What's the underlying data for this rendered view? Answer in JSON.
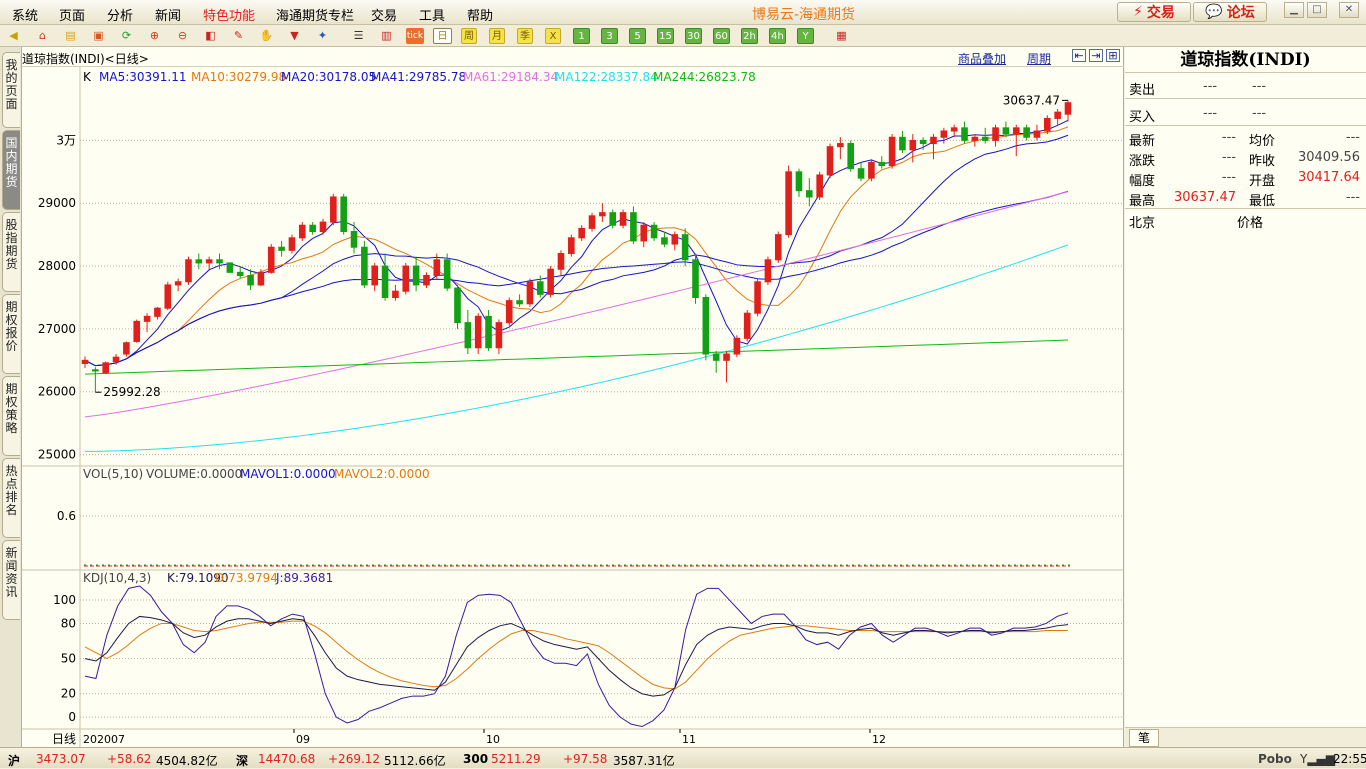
{
  "app_title": "博易云-海通期货",
  "menu": [
    "系统",
    "页面",
    "分析",
    "新闻",
    "特色功能",
    "海通期货专栏",
    "交易",
    "工具",
    "帮助"
  ],
  "top_buttons": {
    "trade": "交易",
    "forum": "论坛"
  },
  "toolbar": {
    "periods": [
      "日",
      "周",
      "月",
      "季",
      "X",
      "1",
      "3",
      "5",
      "15",
      "30",
      "60",
      "2h",
      "4h",
      "Y"
    ],
    "tick": "tick"
  },
  "sidebar": [
    "我的页面",
    "国内期货",
    "股指期货",
    "期权报价",
    "期权策略",
    "热点排名",
    "新闻资讯"
  ],
  "chart": {
    "symbol_title": "道琼指数(INDI)<日线>",
    "overlay_link": "商品叠加",
    "period_link": "周期",
    "ma_prefix": "K",
    "ma_labels": [
      {
        "text": "MA5:30391.11",
        "color": "#1414c8"
      },
      {
        "text": "MA10:30279.98",
        "color": "#e07a12"
      },
      {
        "text": "MA20:30178.05",
        "color": "#1414c8"
      },
      {
        "text": "MA41:29785.78",
        "color": "#1414c8"
      },
      {
        "text": "MA61:29184.34",
        "color": "#e070e0"
      },
      {
        "text": "MA122:28337.84",
        "color": "#1ee0ee"
      },
      {
        "text": "MA244:26823.78",
        "color": "#12b812"
      }
    ],
    "price_ticks": [
      "3万",
      "29000",
      "28000",
      "27000",
      "26000",
      "25000"
    ],
    "high_label": "30637.47",
    "low_label": "25992.28",
    "vol_header": {
      "name": "VOL(5,10)",
      "volume": "VOLUME:0.0000",
      "mavol1": "MAVOL1:0.0000",
      "mavol2": "MAVOL2:0.0000"
    },
    "vol_tick": "0.6",
    "kdj_header": {
      "name": "KDJ(10,4,3)",
      "k": "K:79.1090",
      "d": "D:73.9794",
      "j": "J:89.3681"
    },
    "kdj_ticks": [
      "100",
      "80",
      "50",
      "20",
      "0"
    ],
    "x_axis_name": "日线",
    "x_labels": [
      "202007",
      "09",
      "10",
      "11",
      "12"
    ]
  },
  "chart_data": {
    "type": "candlestick",
    "title": "道琼指数(INDI)<日线>",
    "x_months": [
      "202007",
      "09",
      "10",
      "11",
      "12"
    ],
    "ohlc_approx": [
      [
        26450,
        26560,
        26380,
        26500
      ],
      [
        26350,
        26390,
        25992,
        26330
      ],
      [
        26300,
        26480,
        26280,
        26460
      ],
      [
        26480,
        26600,
        26430,
        26550
      ],
      [
        26600,
        26800,
        26560,
        26780
      ],
      [
        26800,
        27150,
        26780,
        27120
      ],
      [
        27120,
        27250,
        26950,
        27200
      ],
      [
        27200,
        27350,
        27150,
        27330
      ],
      [
        27330,
        27750,
        27300,
        27700
      ],
      [
        27700,
        27800,
        27600,
        27750
      ],
      [
        27750,
        28150,
        27700,
        28100
      ],
      [
        28100,
        28200,
        27950,
        28050
      ],
      [
        28050,
        28150,
        27950,
        28100
      ],
      [
        28100,
        28200,
        27950,
        28050
      ],
      [
        28050,
        28050,
        27900,
        27900
      ],
      [
        27900,
        28000,
        27800,
        27850
      ],
      [
        27850,
        27950,
        27620,
        27700
      ],
      [
        27700,
        27950,
        27680,
        27900
      ],
      [
        27900,
        28350,
        27880,
        28300
      ],
      [
        28300,
        28400,
        28150,
        28250
      ],
      [
        28250,
        28500,
        28200,
        28450
      ],
      [
        28450,
        28700,
        28400,
        28650
      ],
      [
        28650,
        28700,
        28500,
        28550
      ],
      [
        28550,
        28750,
        28500,
        28700
      ],
      [
        28700,
        29150,
        28650,
        29100
      ],
      [
        29100,
        29150,
        28500,
        28550
      ],
      [
        28550,
        28700,
        28200,
        28300
      ],
      [
        28300,
        28400,
        27650,
        27700
      ],
      [
        27700,
        28050,
        27600,
        28000
      ],
      [
        28000,
        28200,
        27450,
        27500
      ],
      [
        27500,
        27700,
        27450,
        27600
      ],
      [
        27600,
        28050,
        27550,
        28000
      ],
      [
        28000,
        28150,
        27600,
        27700
      ],
      [
        27700,
        27900,
        27650,
        27850
      ],
      [
        27850,
        28200,
        27800,
        28100
      ],
      [
        28100,
        28200,
        27600,
        27650
      ],
      [
        27650,
        27700,
        27000,
        27100
      ],
      [
        27100,
        27300,
        26600,
        26700
      ],
      [
        26700,
        27250,
        26600,
        27200
      ],
      [
        27200,
        27300,
        26650,
        26700
      ],
      [
        26700,
        27150,
        26600,
        27100
      ],
      [
        27100,
        27500,
        27050,
        27450
      ],
      [
        27450,
        27550,
        27350,
        27400
      ],
      [
        27400,
        27800,
        27350,
        27750
      ],
      [
        27750,
        27850,
        27500,
        27550
      ],
      [
        27550,
        28000,
        27500,
        27950
      ],
      [
        27950,
        28250,
        27850,
        28200
      ],
      [
        28200,
        28500,
        28150,
        28450
      ],
      [
        28450,
        28650,
        28400,
        28600
      ],
      [
        28600,
        28850,
        28550,
        28800
      ],
      [
        28800,
        29000,
        28700,
        28850
      ],
      [
        28850,
        28900,
        28600,
        28650
      ],
      [
        28650,
        28900,
        28600,
        28850
      ],
      [
        28850,
        28950,
        28350,
        28400
      ],
      [
        28400,
        28700,
        28300,
        28650
      ],
      [
        28650,
        28700,
        28400,
        28450
      ],
      [
        28450,
        28550,
        28300,
        28350
      ],
      [
        28350,
        28550,
        28250,
        28500
      ],
      [
        28500,
        28600,
        28000,
        28100
      ],
      [
        28100,
        28200,
        27400,
        27500
      ],
      [
        27500,
        27550,
        26500,
        26600
      ],
      [
        26600,
        26650,
        26300,
        26500
      ],
      [
        26500,
        26650,
        26150,
        26600
      ],
      [
        26600,
        26900,
        26550,
        26850
      ],
      [
        26850,
        27300,
        26800,
        27250
      ],
      [
        27250,
        27800,
        27200,
        27750
      ],
      [
        27750,
        28150,
        27700,
        28100
      ],
      [
        28100,
        28550,
        28050,
        28500
      ],
      [
        28500,
        29600,
        28450,
        29500
      ],
      [
        29500,
        29550,
        29100,
        29200
      ],
      [
        29200,
        29400,
        28950,
        29100
      ],
      [
        29100,
        29500,
        29050,
        29450
      ],
      [
        29450,
        29950,
        29400,
        29900
      ],
      [
        29900,
        30050,
        29700,
        29950
      ],
      [
        29950,
        30000,
        29500,
        29550
      ],
      [
        29550,
        29650,
        29350,
        29400
      ],
      [
        29400,
        29700,
        29350,
        29650
      ],
      [
        29650,
        29750,
        29550,
        29600
      ],
      [
        29600,
        30100,
        29550,
        30050
      ],
      [
        30050,
        30150,
        29800,
        29850
      ],
      [
        29850,
        30100,
        29650,
        30000
      ],
      [
        30000,
        30050,
        29850,
        29950
      ],
      [
        29950,
        30100,
        29700,
        30050
      ],
      [
        30050,
        30200,
        29950,
        30150
      ],
      [
        30150,
        30250,
        30050,
        30200
      ],
      [
        30200,
        30300,
        29950,
        30000
      ],
      [
        30000,
        30100,
        29900,
        30050
      ],
      [
        30050,
        30200,
        29950,
        30000
      ],
      [
        30000,
        30250,
        29900,
        30200
      ],
      [
        30200,
        30300,
        30050,
        30100
      ],
      [
        30100,
        30250,
        29750,
        30200
      ],
      [
        30200,
        30250,
        30000,
        30050
      ],
      [
        30050,
        30250,
        30000,
        30150
      ],
      [
        30150,
        30400,
        30100,
        30350
      ],
      [
        30350,
        30500,
        30250,
        30450
      ],
      [
        30417.64,
        30637.47,
        30300,
        30600
      ]
    ],
    "ma_series": [
      {
        "name": "MA5",
        "color": "#1414c8"
      },
      {
        "name": "MA10",
        "color": "#e07a12"
      },
      {
        "name": "MA20",
        "color": "#1414c8"
      },
      {
        "name": "MA41",
        "color": "#1414c8"
      },
      {
        "name": "MA61",
        "color": "#e070e0"
      },
      {
        "name": "MA122",
        "color": "#1ee0ee"
      },
      {
        "name": "MA244",
        "color": "#12b812"
      }
    ],
    "ylim": [
      24850,
      30850
    ],
    "kdj": {
      "K": [
        50,
        48,
        55,
        68,
        80,
        86,
        85,
        83,
        80,
        72,
        68,
        70,
        77,
        82,
        84,
        84,
        82,
        80,
        82,
        84,
        83,
        70,
        55,
        42,
        35,
        32,
        30,
        28,
        27,
        26,
        25,
        24,
        23,
        30,
        45,
        60,
        68,
        74,
        78,
        80,
        76,
        70,
        65,
        62,
        60,
        58,
        60,
        50,
        40,
        32,
        25,
        20,
        18,
        19,
        25,
        45,
        62,
        70,
        75,
        77,
        76,
        75,
        78,
        80,
        80,
        78,
        74,
        72,
        72,
        70,
        73,
        75,
        76,
        72,
        70,
        72,
        74,
        74,
        73,
        72,
        73,
        74,
        74,
        72,
        73,
        74,
        74,
        75,
        76,
        78,
        79
      ],
      "D": [
        60,
        55,
        50,
        55,
        62,
        70,
        76,
        80,
        80,
        77,
        74,
        73,
        74,
        76,
        78,
        80,
        81,
        81,
        81,
        82,
        82,
        78,
        72,
        64,
        56,
        49,
        43,
        38,
        34,
        31,
        29,
        27,
        26,
        27,
        33,
        41,
        50,
        58,
        65,
        71,
        74,
        74,
        72,
        70,
        67,
        65,
        63,
        61,
        55,
        48,
        41,
        34,
        28,
        25,
        24,
        30,
        40,
        50,
        58,
        65,
        70,
        72,
        74,
        76,
        77,
        78,
        78,
        77,
        76,
        75,
        74,
        74,
        74,
        73,
        73,
        73,
        73,
        73,
        73,
        73,
        73,
        73,
        73,
        73,
        73,
        73,
        73,
        73,
        74,
        74,
        74
      ],
      "J": [
        35,
        33,
        70,
        95,
        110,
        112,
        104,
        90,
        80,
        62,
        55,
        64,
        86,
        95,
        95,
        92,
        86,
        78,
        84,
        88,
        86,
        55,
        20,
        0,
        -5,
        -2,
        5,
        8,
        12,
        16,
        18,
        18,
        20,
        35,
        70,
        98,
        104,
        105,
        104,
        98,
        80,
        62,
        50,
        46,
        46,
        44,
        54,
        28,
        10,
        0,
        -6,
        -8,
        -3,
        6,
        25,
        75,
        105,
        110,
        110,
        100,
        90,
        80,
        86,
        88,
        88,
        78,
        66,
        62,
        64,
        58,
        70,
        77,
        80,
        70,
        64,
        70,
        76,
        76,
        73,
        69,
        72,
        76,
        76,
        70,
        72,
        76,
        76,
        77,
        80,
        86,
        89
      ]
    }
  },
  "quote_panel": {
    "title": "道琼指数(INDI)",
    "sell_label": "卖出",
    "sell_price": "---",
    "sell_vol": "---",
    "buy_label": "买入",
    "buy_price": "---",
    "buy_vol": "---",
    "rows": [
      {
        "l1": "最新",
        "v1": "---",
        "l2": "均价",
        "v2": "---",
        "c1": "#444",
        "c2": "#444"
      },
      {
        "l1": "涨跌",
        "v1": "---",
        "l2": "昨收",
        "v2": "30409.56",
        "c1": "#444",
        "c2": "#444"
      },
      {
        "l1": "幅度",
        "v1": "---",
        "l2": "开盘",
        "v2": "30417.64",
        "c1": "#444",
        "c2": "#e0201c"
      },
      {
        "l1": "最高",
        "v1": "30637.47",
        "l2": "最低",
        "v2": "---",
        "c1": "#e0201c",
        "c2": "#444"
      }
    ],
    "beijing_label": "北京",
    "price_label": "价格",
    "bottom_tab": "笔"
  },
  "status": {
    "sh_label": "沪",
    "sh_index": "3473.07",
    "sh_change": "+58.62",
    "sh_amount": "4504.82亿",
    "sz_label": "深",
    "sz_index": "14470.68",
    "sz_change": "+269.12",
    "sz_amount": "5112.66亿",
    "c300_label": "300",
    "c300_index": "5211.29",
    "c300_change": "+97.58",
    "c300_amount": "3587.31亿",
    "brand": "Pobo",
    "time": "22:55"
  }
}
